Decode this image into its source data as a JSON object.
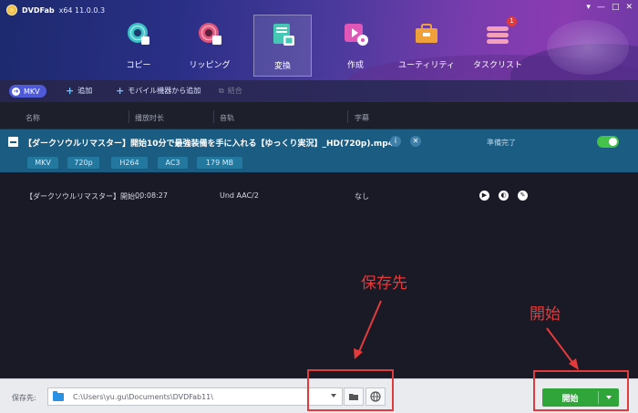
{
  "app": {
    "logo_text": "DVDFab",
    "version": "x64  11.0.0.3"
  },
  "window_controls": [
    "▾",
    "—",
    "□",
    "✕"
  ],
  "nav": [
    {
      "label": "コピー",
      "icon": "disc-copy-icon"
    },
    {
      "label": "リッピング",
      "icon": "disc-ripper-icon"
    },
    {
      "label": "変換",
      "icon": "converter-icon",
      "active": true
    },
    {
      "label": "作成",
      "icon": "creator-icon"
    },
    {
      "label": "ユーティリティ",
      "icon": "utility-icon"
    },
    {
      "label": "タスクリスト",
      "icon": "task-list-icon",
      "badge": "1"
    }
  ],
  "toolbar": {
    "profile": "MKV",
    "add": "追加",
    "add_mobile": "モバイル機器から追加",
    "merge": "結合"
  },
  "columns": [
    "名称",
    "播放时长",
    "音轨",
    "字幕"
  ],
  "file": {
    "name": "【ダークソウルリマスター】開始10分で最強装備を手に入れる【ゆっくり実況】_HD(720p).mp4",
    "status": "準備完了",
    "enabled": true,
    "tags": [
      "MKV",
      "720p",
      "H264",
      "AC3",
      "179 MB"
    ]
  },
  "track": {
    "title": "【ダークソウルリマスター】開始...",
    "duration": "00:08:27",
    "audio": "Und AAC/2",
    "subtitle": "なし"
  },
  "annotations": {
    "save_to": "保存先",
    "start": "開始"
  },
  "bottom": {
    "save_label": "保存先:",
    "path": "C:\\Users\\yu.gu\\Documents\\DVDFab11\\",
    "start_label": "開始"
  },
  "colors": {
    "selected_row": "#1b5c83",
    "start_green": "#2fa53a",
    "annotation_red": "#e33b3b",
    "accent_blue": "#4e5ad8"
  }
}
